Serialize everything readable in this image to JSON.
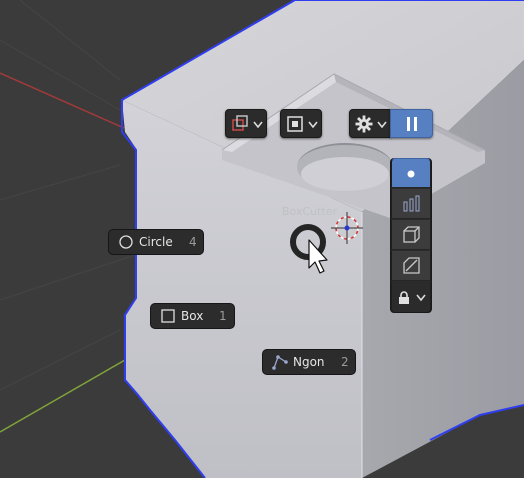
{
  "viewport": {
    "label_hint": "BoxCutter",
    "colors": {
      "background": "#3b3b3b",
      "x_axis": "#a33a3a",
      "y_axis": "#7fa33a",
      "accent": "#5680c2",
      "object_outline": "#2f3ef0"
    }
  },
  "toolbar": {
    "mode_icon": "intersect-shape-icon",
    "snap_icon": "square-in-square-icon",
    "settings_icon": "gear-icon",
    "pause_icon": "pause-icon"
  },
  "side_tools": {
    "items": [
      "dot-icon",
      "bars-icon",
      "extrude-box-icon",
      "bevel-corner-icon"
    ],
    "lock_icon": "lock-icon"
  },
  "pie_menu": {
    "items": [
      {
        "label": "Circle",
        "key": "4",
        "icon": "circle-icon"
      },
      {
        "label": "Box",
        "key": "1",
        "icon": "square-icon"
      },
      {
        "label": "Ngon",
        "key": "2",
        "icon": "ngon-icon"
      }
    ]
  }
}
